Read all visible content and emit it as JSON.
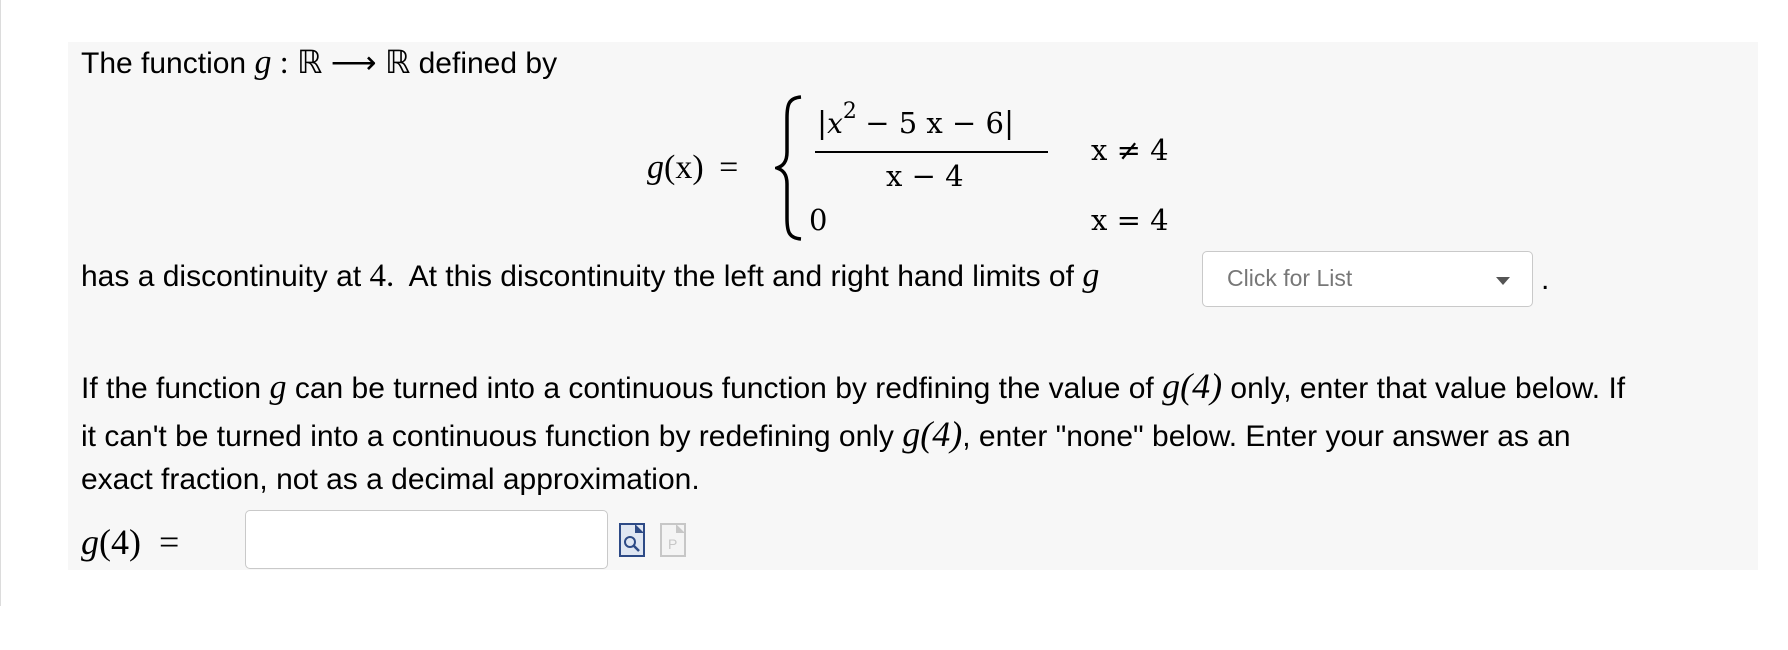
{
  "intro": {
    "prefix": "The function",
    "g": "g",
    "colon": ":",
    "domain": "ℝ",
    "arrow": "⟶",
    "codomain": "ℝ",
    "suffix": "defined by"
  },
  "piecewise": {
    "lhs_name": "g",
    "lhs_arg": "(x)",
    "equals": "=",
    "numerator_abs_open": "|",
    "numerator_x": "x",
    "numerator_exp": "2",
    "numerator_rest": "− 5 x − 6",
    "numerator_abs_close": "|",
    "denominator": "x − 4",
    "case1_condition": "x ≠ 4",
    "case2_value": "0",
    "case2_condition": "x = 4"
  },
  "sentence": {
    "prefix": "has a discontinuity at",
    "point": "4.",
    "middle": "At this discontinuity the left and right hand limits of",
    "g": "g",
    "period": "."
  },
  "dropdown": {
    "placeholder": "Click for List"
  },
  "question": {
    "line1_a": "If the function",
    "line1_g": "g",
    "line1_b": "can be turned into a continuous function by redfining the value of",
    "line1_g4": "g(4)",
    "line1_c": "only, enter that value below.  If",
    "line2_a": "it can't be turned into a continuous function by redefining only",
    "line2_g4": "g(4)",
    "line2_b": ", enter \"none\" below.  Enter your answer as an",
    "line3": "exact fraction, not as a decimal approximation."
  },
  "answer": {
    "label_g": "g",
    "label_arg": "(4)",
    "label_eq": "=",
    "value": "",
    "preview_icon": "preview-icon",
    "paste_icon": "paste-icon"
  }
}
